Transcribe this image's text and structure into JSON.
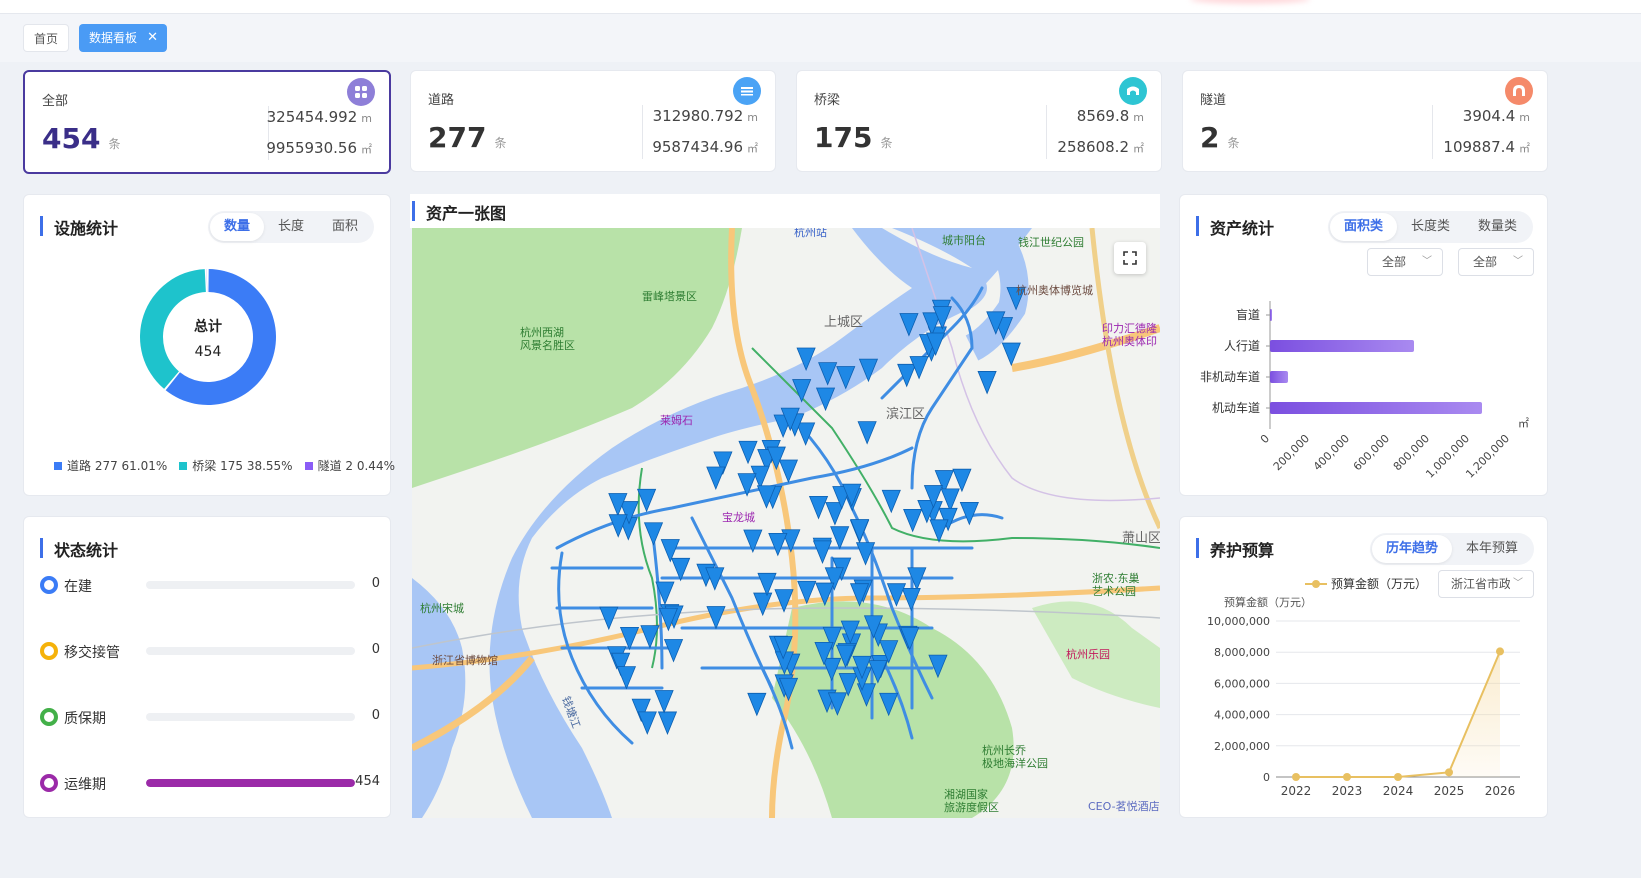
{
  "tabs": {
    "home": "首页",
    "active": "数据看板",
    "close": "✕"
  },
  "stats": [
    {
      "label": "全部",
      "count": "454",
      "unit": "条",
      "length": "325454.992",
      "length_unit": "m",
      "area": "9955930.56",
      "area_unit": "㎡",
      "icon": "grid-icon",
      "color": "#8e7fd8"
    },
    {
      "label": "道路",
      "count": "277",
      "unit": "条",
      "length": "312980.792",
      "length_unit": "m",
      "area": "9587434.96",
      "area_unit": "㎡",
      "icon": "road-icon",
      "color": "#4aa3f5"
    },
    {
      "label": "桥梁",
      "count": "175",
      "unit": "条",
      "length": "8569.8",
      "length_unit": "m",
      "area": "258608.2",
      "area_unit": "㎡",
      "icon": "bridge-icon",
      "color": "#2ec5d3"
    },
    {
      "label": "隧道",
      "count": "2",
      "unit": "条",
      "length": "3904.4",
      "length_unit": "m",
      "area": "109887.4",
      "area_unit": "㎡",
      "icon": "tunnel-icon",
      "color": "#f58a6a"
    }
  ],
  "facility": {
    "title": "设施统计",
    "tabs": [
      "数量",
      "长度",
      "面积"
    ],
    "active_tab": "数量",
    "center_label": "总计",
    "center_value": "454",
    "legend": [
      {
        "label": "道路 277 61.01%",
        "color": "#3b7cf6"
      },
      {
        "label": "桥梁 175 38.55%",
        "color": "#1ec3cc"
      },
      {
        "label": "隧道 2 0.44%",
        "color": "#8a5cf6"
      }
    ]
  },
  "donut": [
    {
      "name": "道路",
      "value": 277,
      "color": "#3b7cf6"
    },
    {
      "name": "桥梁",
      "value": 175,
      "color": "#1ec3cc"
    },
    {
      "name": "隧道",
      "value": 2,
      "color": "#8a5cf6"
    }
  ],
  "status": {
    "title": "状态统计",
    "rows": [
      {
        "label": "在建",
        "value": 0,
        "color": "#3b7cf6",
        "bar": "#3b7cf6"
      },
      {
        "label": "移交接管",
        "value": 0,
        "color": "#f5b20a",
        "bar": "#f5b20a"
      },
      {
        "label": "质保期",
        "value": 0,
        "color": "#43b049",
        "bar": "#43b049"
      },
      {
        "label": "运维期",
        "value": 454,
        "color": "#9b2aa8",
        "bar": "#9b2aa8"
      }
    ],
    "max": 454
  },
  "map": {
    "title": "资产一张图",
    "labels": {
      "hz_station": "杭州站",
      "city_balcony": "城市阳台",
      "qj_park": "钱江世纪公园",
      "expo": "杭州奥体博览城",
      "leifeng": "雷峰塔景区",
      "westlake1": "杭州西湖",
      "westlake2": "风景名胜区",
      "shangcheng": "上城区",
      "yinli1": "印力汇德隆",
      "yinli2": "杭州奥体印",
      "laimu": "莱姆石",
      "binjiang": "滨江区",
      "baolong": "宝龙城",
      "xiaoshan": "萧山区",
      "zj_east1": "浙农·东巢",
      "zj_east2": "艺术公园",
      "songcheng": "杭州宋城",
      "museum": "浙江省博物馆",
      "leyuan": "杭州乐园",
      "changqiao1": "杭州长乔",
      "changqiao2": "极地海洋公园",
      "xianghu1": "湘湖国家",
      "xianghu2": "旅游度假区",
      "ceo": "CEO-茗悦酒店",
      "qiantang": "钱塘江"
    }
  },
  "asset": {
    "title": "资产统计",
    "tabs": [
      "面积类",
      "长度类",
      "数量类"
    ],
    "active_tab": "面积类",
    "dd1": "全部",
    "dd2": "全部",
    "unit_label": "㎡"
  },
  "chart_data": [
    {
      "type": "bar",
      "orientation": "horizontal",
      "categories": [
        "盲道",
        "人行道",
        "非机动车道",
        "机动车道"
      ],
      "values": [
        5000,
        720000,
        90000,
        1060000
      ],
      "xlim": [
        0,
        1200000
      ],
      "xticks": [
        "0",
        "200,000",
        "400,000",
        "600,000",
        "800,000",
        "1,000,000",
        "1,200,000"
      ],
      "xunit": "㎡",
      "color": "#8a5cf6"
    },
    {
      "type": "area",
      "title": "",
      "x": [
        "2022",
        "2023",
        "2024",
        "2025",
        "2026"
      ],
      "series": [
        {
          "name": "预算金额（万元）",
          "values": [
            0,
            0,
            0,
            300000,
            8050000
          ]
        }
      ],
      "ylabel": "预算金额（万元）",
      "ylim": [
        0,
        10000000
      ],
      "yticks": [
        "10,000,000",
        "8,000,000",
        "6,000,000",
        "4,000,000",
        "2,000,000",
        "0"
      ],
      "color": "#e8c061"
    }
  ],
  "budget": {
    "title": "养护预算",
    "tabs": [
      "历年趋势",
      "本年预算"
    ],
    "active_tab": "历年趋势",
    "legend": "预算金额（万元）",
    "dd": "浙江省市政",
    "ylabel": "预算金额（万元）"
  }
}
